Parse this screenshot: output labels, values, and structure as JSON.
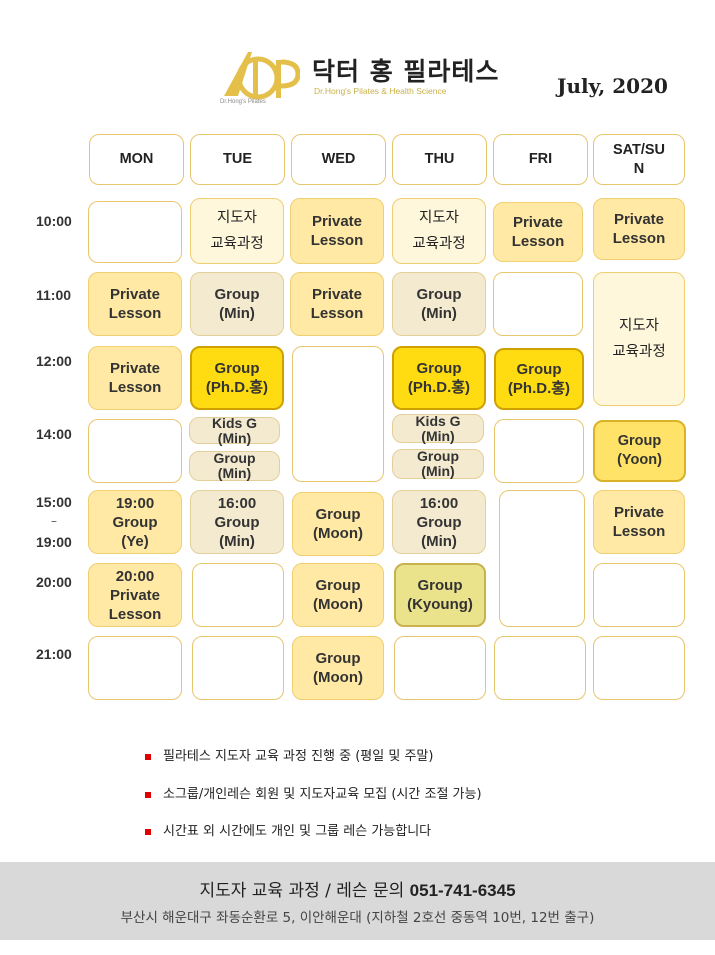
{
  "brand": {
    "logo_text": "Dr.Hong's Pilates",
    "name_ko": "닥터 홍 필라테스",
    "name_en": "Dr.Hong's Pilates & Health Science"
  },
  "month": "July, 2020",
  "days": [
    "MON",
    "TUE",
    "WED",
    "THU",
    "FRI",
    "SAT/SU\nN"
  ],
  "times": {
    "t1000": "10:00",
    "t1100": "11:00",
    "t1200": "12:00",
    "t1400": "14:00",
    "t1500": "15:00",
    "dash": "–",
    "t1900": "19:00",
    "t2000": "20:00",
    "t2100": "21:00"
  },
  "sessions": {
    "tue_1000": "지도자\n교육과정",
    "wed_1000": "Private\nLesson",
    "thu_1000": "지도자\n교육과정",
    "fri_1000": "Private\nLesson",
    "sat_1000": "Private\nLesson",
    "mon_1100": "Private\nLesson",
    "tue_1100": "Group\n(Min)",
    "wed_1100": "Private\nLesson",
    "thu_1100": "Group\n(Min)",
    "sat_1100": "지도자\n교육과정",
    "mon_1200": "Private\nLesson",
    "tue_1200": "Group\n(Ph.D.홍)",
    "thu_1200": "Group\n(Ph.D.홍)",
    "fri_1200": "Group\n(Ph.D.홍)",
    "tue_1400a": "Kids G\n(Min)",
    "tue_1400b": "Group\n(Min)",
    "thu_1400a": "Kids G\n(Min)",
    "thu_1400b": "Group\n(Min)",
    "sat_1400": "Group\n(Yoon)",
    "mon_1500": "19:00\nGroup\n(Ye)",
    "tue_1500": "16:00\nGroup\n(Min)",
    "wed_1500": "Group\n(Moon)",
    "thu_1500": "16:00\nGroup\n(Min)",
    "sat_1500": "Private\nLesson",
    "mon_2000": "20:00\nPrivate\nLesson",
    "wed_2000": "Group\n(Moon)",
    "thu_2000": "Group\n(Kyoung)",
    "wed_2100": "Group\n(Moon)"
  },
  "notes": [
    "필라테스 지도자 교육 과정 진행 중 (평일 및 주말)",
    "소그룹/개인레슨 회원 및 지도자교육 모집 (시간 조절 가능)",
    "시간표 외 시간에도 개인 및 그룹 레슨 가능합니다"
  ],
  "footer": {
    "contact_label": "지도자 교육 과정 / 레슨 문의",
    "phone": "051-741-6345",
    "address": "부산시 해운대구 좌동순환로 5, 이안해운대 (지하철 2호선 중동역 10번, 12번 출구)"
  },
  "colors": {
    "private": "#ffe9a4",
    "group_min": "#f3ead0",
    "group_gold": "#ffdc12",
    "group_olive": "#ebe38c",
    "border": "#e8c66d",
    "bullet": "#e00000",
    "footer_bg": "#d9d9d9"
  }
}
